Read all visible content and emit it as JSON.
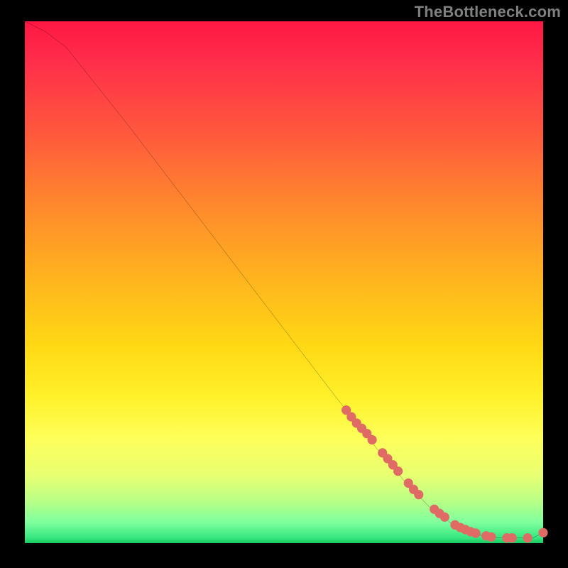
{
  "attribution": "TheBottleneck.com",
  "chart_data": {
    "type": "line",
    "title": "",
    "xlabel": "",
    "ylabel": "",
    "xlim": [
      0,
      100
    ],
    "ylim": [
      0,
      100
    ],
    "legend": false,
    "grid": false,
    "background_gradient": [
      "#ff1744",
      "#ff8b2c",
      "#fff12a",
      "#17c95e"
    ],
    "series": [
      {
        "name": "bottleneck-curve",
        "stroke": "#000000",
        "x": [
          0,
          4,
          8,
          12,
          20,
          30,
          40,
          50,
          60,
          68,
          74,
          78,
          82,
          86,
          90,
          94,
          98,
          100
        ],
        "y": [
          100,
          98,
          95,
          90,
          80,
          67,
          54,
          41,
          28,
          18,
          11,
          7,
          4,
          2,
          1,
          1,
          1,
          2
        ]
      }
    ],
    "markers": [
      {
        "series": "bottleneck-curve",
        "color": "#e06a64",
        "x": [
          62,
          63,
          64,
          65,
          66,
          67,
          69,
          70,
          71,
          72,
          74,
          75,
          76,
          79,
          80,
          81,
          83,
          84,
          85,
          86,
          87,
          89,
          90,
          93,
          94,
          97,
          100
        ],
        "y": [
          25.5,
          24.2,
          23,
          22,
          21,
          19.8,
          17.3,
          16.2,
          15,
          13.8,
          11.5,
          10.3,
          9.3,
          6.5,
          5.7,
          5,
          3.5,
          3,
          2.6,
          2.2,
          1.9,
          1.4,
          1.2,
          1.0,
          1.0,
          1.0,
          2.0
        ]
      }
    ]
  }
}
